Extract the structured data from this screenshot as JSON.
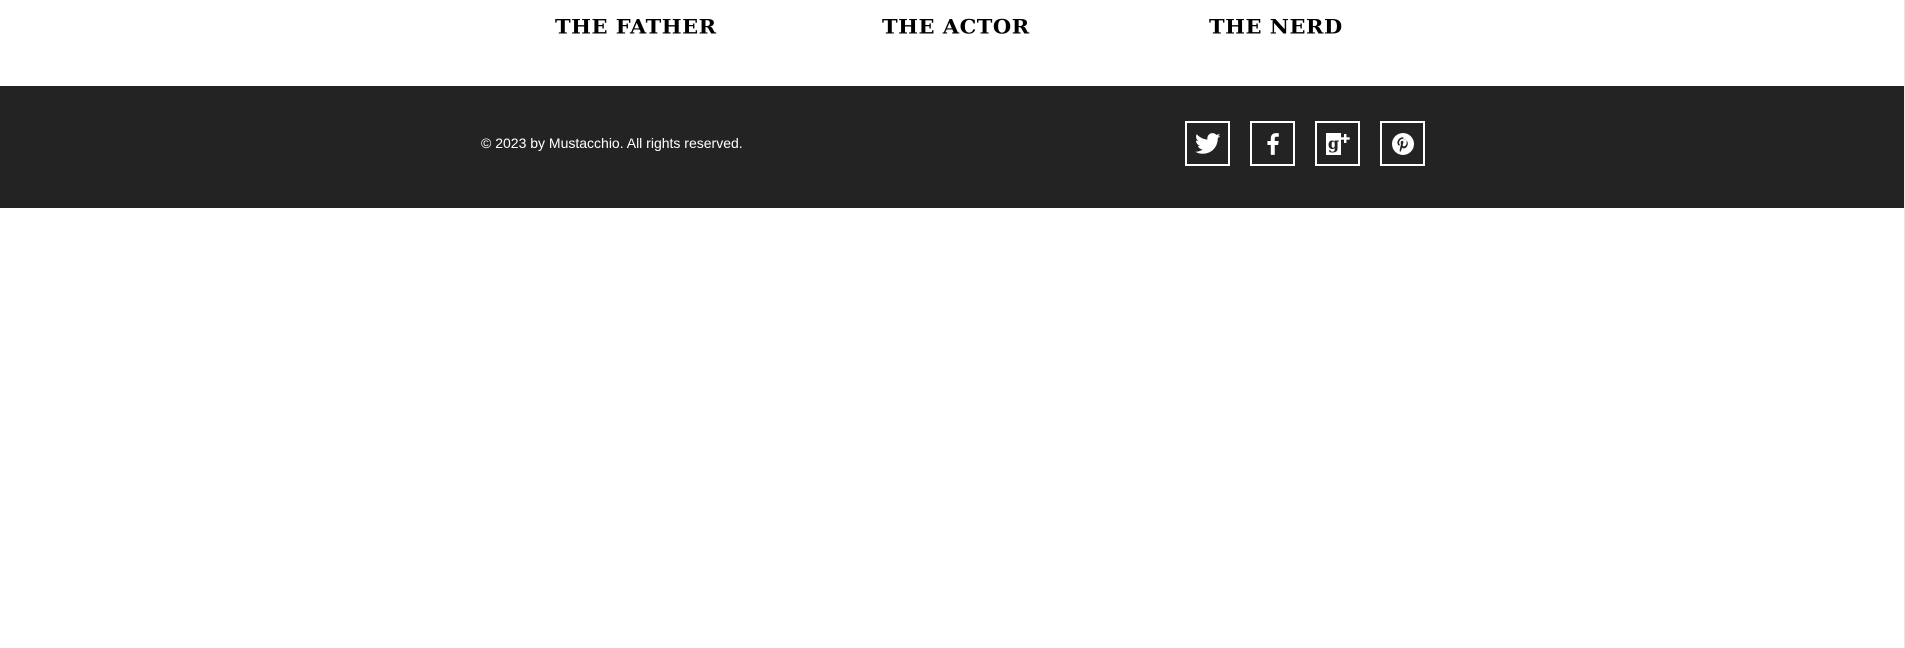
{
  "headings": {
    "father": "THE FATHER",
    "actor": "THE ACTOR",
    "nerd": "THE NERD"
  },
  "footer": {
    "copyright": "© 2023 by Mustacchio. All rights reserved.",
    "social": [
      {
        "icon": "twitter-icon"
      },
      {
        "icon": "facebook-icon"
      },
      {
        "icon": "google-plus-icon"
      },
      {
        "icon": "pinterest-icon"
      }
    ]
  },
  "colors": {
    "footer_background": "#232323",
    "footer_text": "#ffffff",
    "heading_text": "#000000",
    "page_background": "#ffffff"
  }
}
